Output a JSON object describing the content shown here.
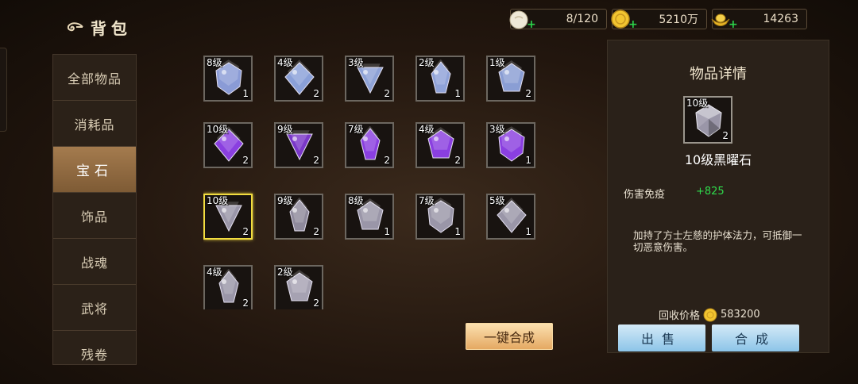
{
  "header": {
    "title": "背包",
    "back_icon": "cloud-back-icon"
  },
  "currencies": [
    {
      "icon": "bun-icon",
      "value": "8/120"
    },
    {
      "icon": "gold-coin-icon",
      "value": "5210万"
    },
    {
      "icon": "gold-ingot-icon",
      "value": "14263"
    }
  ],
  "sidebar": {
    "tabs": [
      {
        "label": "全部物品"
      },
      {
        "label": "消耗品"
      },
      {
        "label": "宝石",
        "active": true
      },
      {
        "label": "饰品"
      },
      {
        "label": "战魂"
      },
      {
        "label": "武将"
      },
      {
        "label": "残卷"
      }
    ]
  },
  "inventory": {
    "rows": [
      [
        {
          "level": "8级",
          "count": "1",
          "color": "#8a9bd6"
        },
        {
          "level": "4级",
          "count": "2",
          "color": "#8aa0d8"
        },
        {
          "level": "3级",
          "count": "2",
          "color": "#8ea2d6"
        },
        {
          "level": "2级",
          "count": "1",
          "color": "#8fa2d8"
        },
        {
          "level": "1级",
          "count": "2",
          "color": "#8a9ed4"
        }
      ],
      [
        {
          "level": "10级",
          "count": "2",
          "color": "#8a3fe0"
        },
        {
          "level": "9级",
          "count": "2",
          "color": "#7a38c8"
        },
        {
          "level": "7级",
          "count": "2",
          "color": "#8a3fe0"
        },
        {
          "level": "4级",
          "count": "2",
          "color": "#8a3fe0"
        },
        {
          "level": "3级",
          "count": "1",
          "color": "#8a3fe0"
        }
      ],
      [
        {
          "level": "10级",
          "count": "2",
          "color": "#9a96a8",
          "selected": true
        },
        {
          "level": "9级",
          "count": "2",
          "color": "#8f8a9c"
        },
        {
          "level": "8级",
          "count": "1",
          "color": "#9a96a8"
        },
        {
          "level": "7级",
          "count": "1",
          "color": "#9a96a8"
        },
        {
          "level": "5级",
          "count": "1",
          "color": "#9a96a8"
        }
      ],
      [
        {
          "level": "4级",
          "count": "2",
          "color": "#9a96a8"
        },
        {
          "level": "2级",
          "count": "2",
          "color": "#a6a2b2"
        }
      ]
    ],
    "merge_all_label": "一键合成"
  },
  "detail": {
    "title": "物品详情",
    "item_level": "10级",
    "item_count": "2",
    "item_name": "10级黑曜石",
    "stat_label": "伤害免疫",
    "stat_value": "+825",
    "description": "加持了方士左慈的护体法力，可抵御一切恶意伤害。",
    "price_label": "回收价格",
    "price_value": "583200",
    "sell_label": "出售",
    "combine_label": "合成"
  },
  "colors": {
    "accent_gold": "#f2dd40",
    "stat_green": "#2fdc4c",
    "button_blue": "#8cc4e8",
    "button_orange": "#e4a760"
  }
}
